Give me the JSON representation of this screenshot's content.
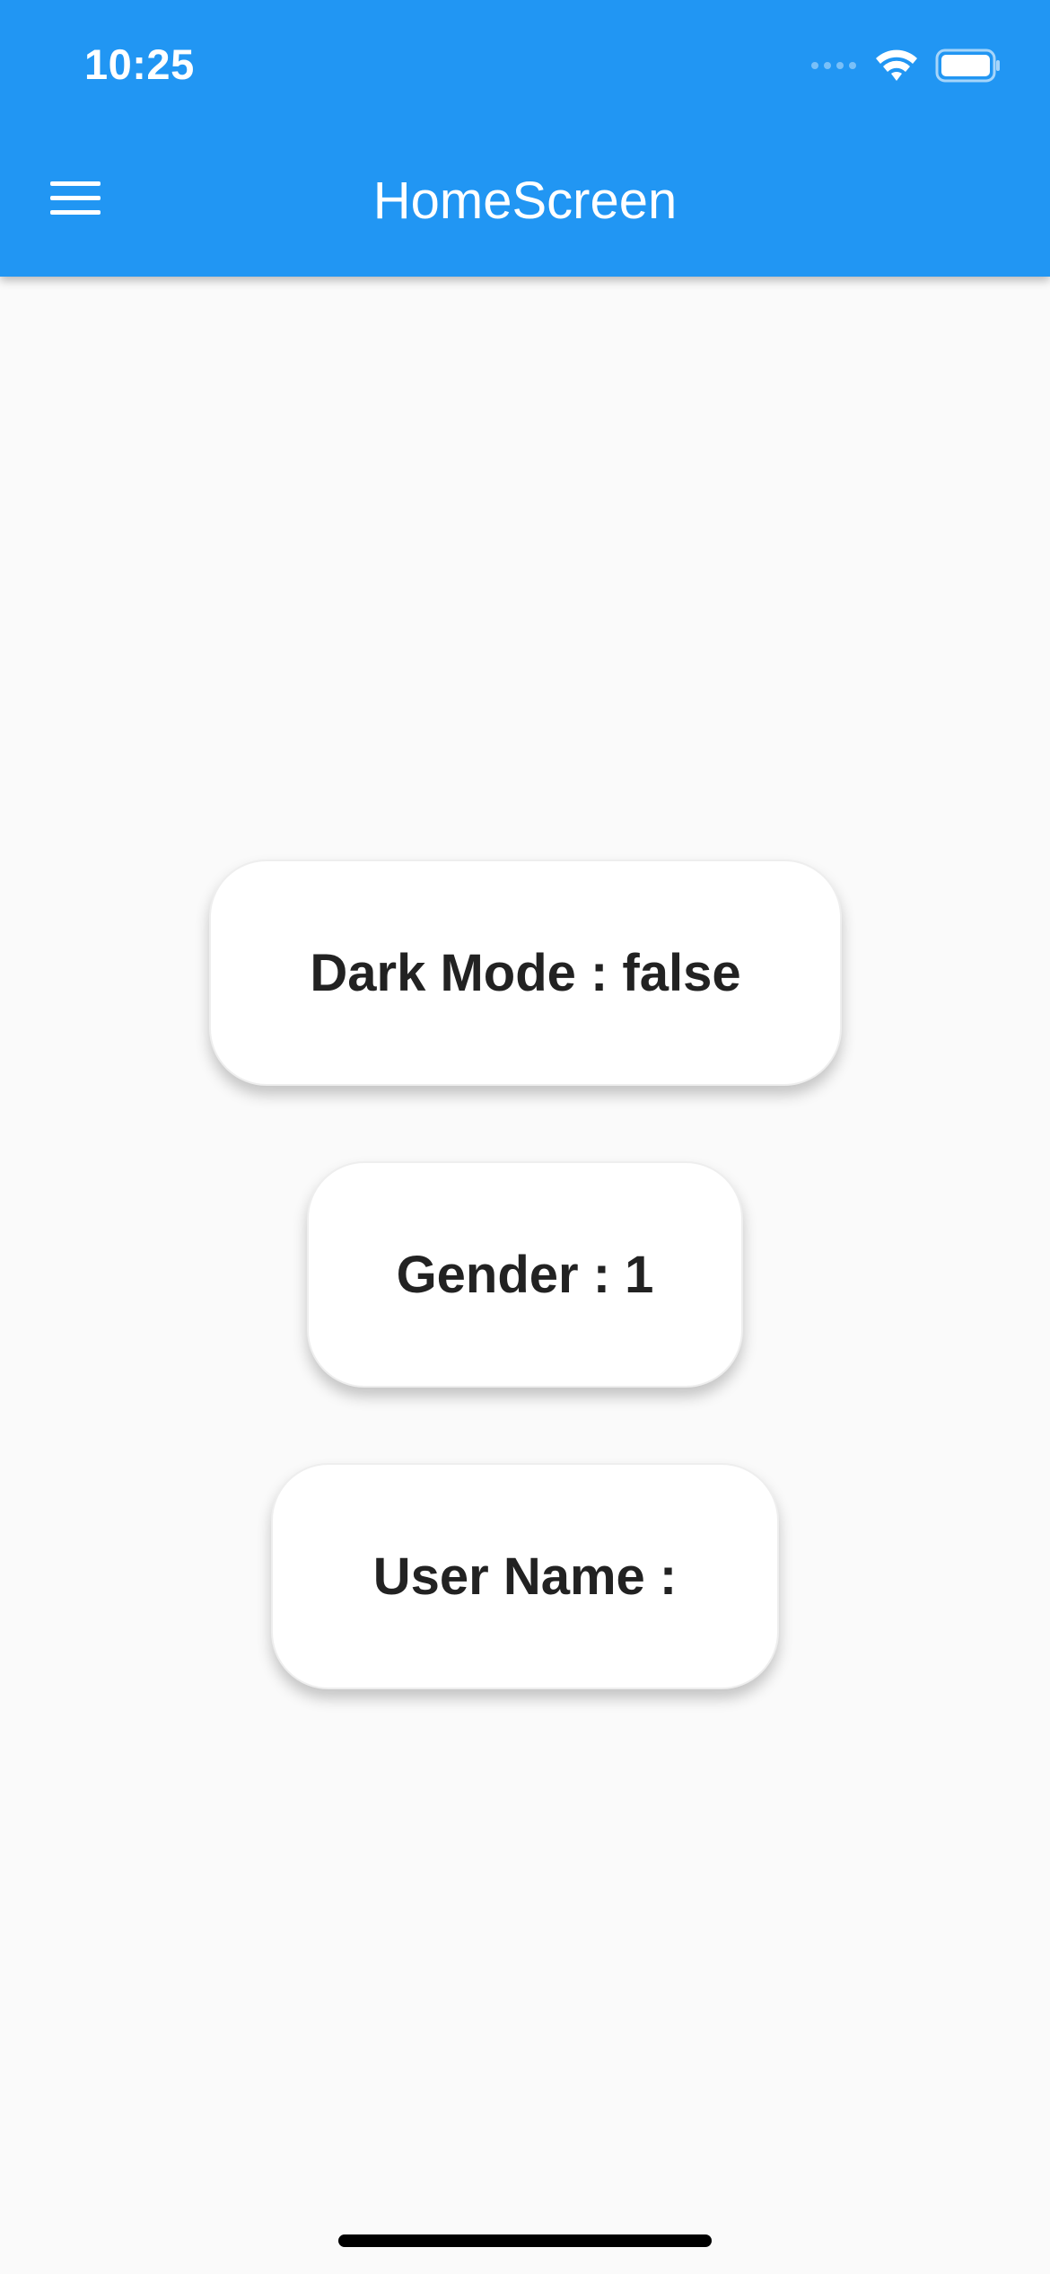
{
  "status_bar": {
    "time": "10:25",
    "icons": [
      "signal-icon",
      "wifi-icon",
      "battery-icon"
    ]
  },
  "app_bar": {
    "title": "HomeScreen",
    "menu_icon": "menu-icon",
    "background_color": "#2196F3"
  },
  "cards": {
    "dark_mode": "Dark Mode : false",
    "gender": "Gender : 1",
    "user_name": "User Name :"
  },
  "colors": {
    "background": "#FAFAFA",
    "card": "#FFFFFF",
    "text": "#222222"
  }
}
